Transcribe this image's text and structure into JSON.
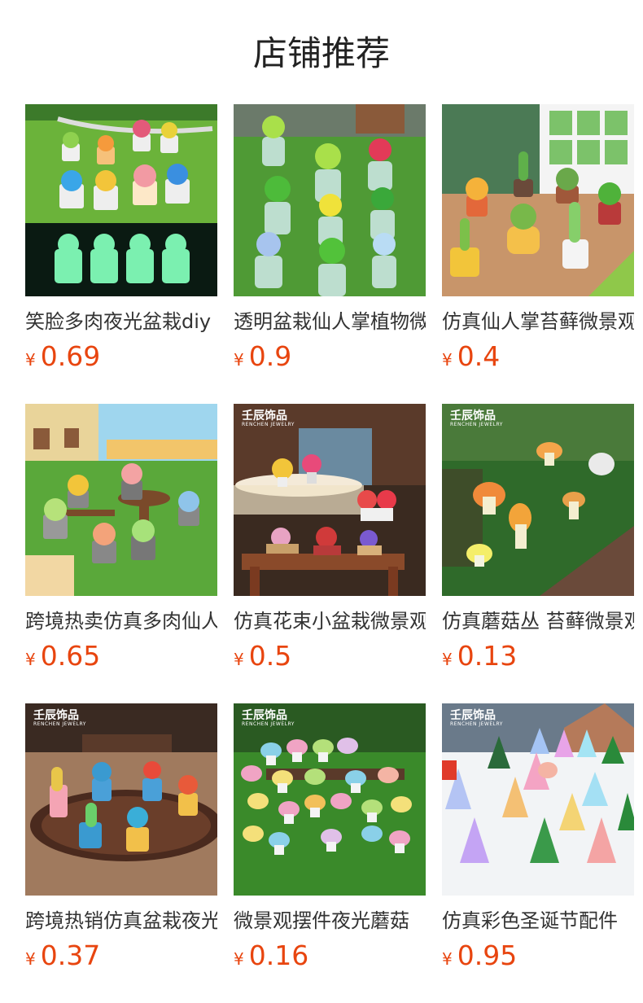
{
  "page": {
    "title": "店铺推荐"
  },
  "products": [
    {
      "name": "笑脸多肉夜光盆栽diy",
      "currency": "¥",
      "price": "0.69"
    },
    {
      "name": "透明盆栽仙人掌植物微景观",
      "currency": "¥",
      "price": "0.9"
    },
    {
      "name": "仿真仙人掌苔藓微景观",
      "currency": "¥",
      "price": "0.4"
    },
    {
      "name": "跨境热卖仿真多肉仙人掌",
      "currency": "¥",
      "price": "0.65"
    },
    {
      "name": "仿真花束小盆栽微景观",
      "currency": "¥",
      "price": "0.5",
      "brand": "壬辰饰品",
      "brand_sub": "RENCHEN JEWELRY"
    },
    {
      "name": "仿真蘑菇丛 苔藓微景观",
      "currency": "¥",
      "price": "0.13",
      "brand": "壬辰饰品",
      "brand_sub": "RENCHEN JEWELRY"
    },
    {
      "name": "跨境热销仿真盆栽夜光",
      "currency": "¥",
      "price": "0.37",
      "brand": "壬辰饰品",
      "brand_sub": "RENCHEN JEWELRY"
    },
    {
      "name": "微景观摆件夜光蘑菇",
      "currency": "¥",
      "price": "0.16",
      "brand": "壬辰饰品",
      "brand_sub": "RENCHEN JEWELRY"
    },
    {
      "name": "仿真彩色圣诞节配件",
      "currency": "¥",
      "price": "0.95",
      "brand": "壬辰饰品",
      "brand_sub": "RENCHEN JEWELRY"
    }
  ]
}
